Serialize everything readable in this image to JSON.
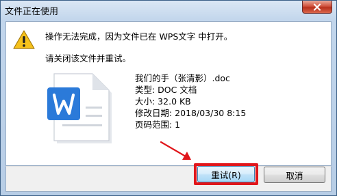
{
  "window": {
    "title": "文件正在使用",
    "close_icon": "close-icon"
  },
  "message": {
    "line1": "操作无法完成，因为文件已在 WPS文字 中打开。",
    "line2": "请关闭该文件并重试。",
    "icon": "warning-icon"
  },
  "file": {
    "icon": "wps-document-icon",
    "name": "我们的手（张清影）.doc",
    "type": "类型: DOC 文档",
    "size": "大小: 32.0 KB",
    "modified": "修改日期: 2018/03/30 8:15",
    "pages": "页码范围: 1"
  },
  "buttons": {
    "retry": "重试(R)",
    "cancel": "取消"
  },
  "colors": {
    "highlight": "#e0161b",
    "wps_blue": "#2b7ad9",
    "warning_yellow": "#f6c21c"
  }
}
